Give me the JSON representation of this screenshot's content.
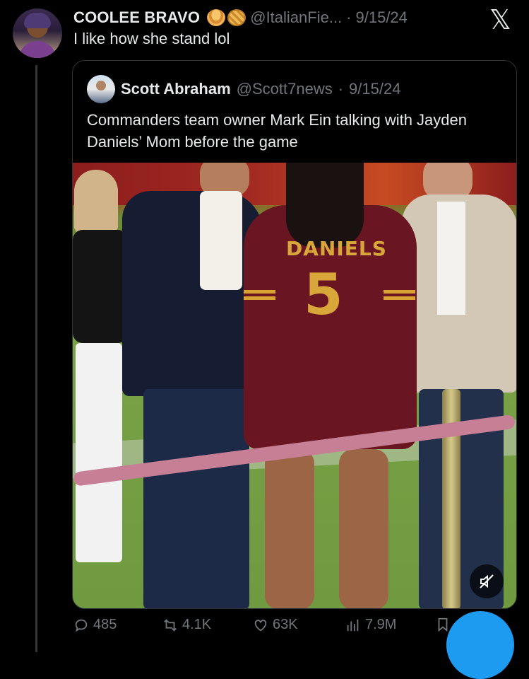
{
  "tweet": {
    "author_name": "COOLEE BRAVO",
    "author_handle": "@ItalianFie...",
    "separator": "·",
    "date": "9/15/24",
    "text": "I like how she stand lol"
  },
  "quote": {
    "author_name": "Scott Abraham",
    "author_handle": "@Scott7news",
    "separator": "·",
    "date": "9/15/24",
    "text": "Commanders team owner Mark Ein talking with Jayden Daniels’ Mom before the game",
    "photo": {
      "jersey_name": "DANIELS",
      "jersey_number": "5"
    }
  },
  "actions": {
    "replies": "485",
    "reposts": "4.1K",
    "likes": "63K",
    "views": "7.9M"
  },
  "icons": {
    "logo": "x-logo-icon",
    "mute": "volume-muted-icon",
    "reply": "reply-icon",
    "repost": "repost-icon",
    "like": "heart-icon",
    "views": "analytics-icon",
    "bookmark": "bookmark-icon",
    "compose": "compose-button"
  },
  "colors": {
    "accent": "#1d9bf0",
    "text": "#e7e9ea",
    "muted": "#71767b",
    "background": "#000000"
  }
}
